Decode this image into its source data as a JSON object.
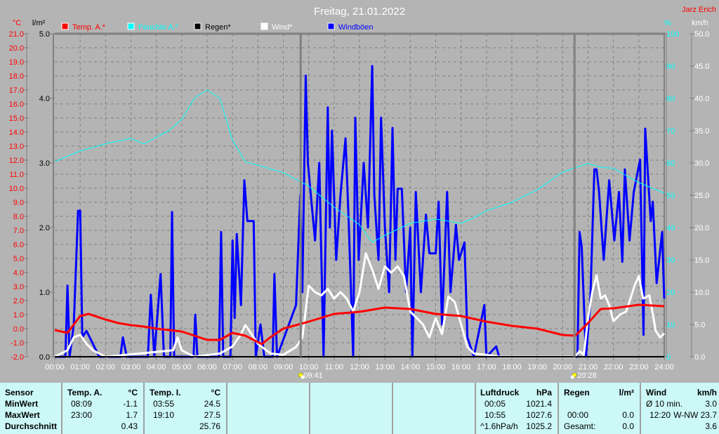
{
  "title": "Freitag, 21.01.2022",
  "author": "Jarz Erich",
  "chart_data": {
    "type": "line",
    "title": "Freitag, 21.01.2022",
    "xlabel": "",
    "x_ticks": [
      "00:00",
      "01:00",
      "02:00",
      "03:00",
      "04:00",
      "05:00",
      "06:00",
      "07:00",
      "08:00",
      "09:00",
      "10:00",
      "11:00",
      "12:00",
      "13:00",
      "14:00",
      "15:00",
      "16:00",
      "17:00",
      "18:00",
      "19:00",
      "20:00",
      "21:00",
      "22:00",
      "23:00",
      "24:00"
    ],
    "xlim": [
      "00:00",
      "24:00"
    ],
    "grid": true,
    "legend_placement": "top",
    "axes": {
      "temp": {
        "unit": "°C",
        "range": [
          -2.0,
          21.0
        ],
        "ticks": [
          "21.0",
          "20.0",
          "19.0",
          "18.0",
          "17.0",
          "16.0",
          "15.0",
          "14.0",
          "13.0",
          "12.0",
          "11.0",
          "10.0",
          "9.0",
          "8.0",
          "7.0",
          "6.0",
          "5.0",
          "4.0",
          "3.0",
          "2.0",
          "1.0",
          "0.0",
          "-1.0",
          "-2.0"
        ],
        "color": "#ff0000"
      },
      "rain": {
        "unit": "l/m²",
        "range": [
          0,
          5.0
        ],
        "ticks": [
          "5.0",
          "4.0",
          "3.0",
          "2.0",
          "1.0",
          "0.0"
        ],
        "color": "#000000"
      },
      "humidity": {
        "unit": "%",
        "range": [
          0,
          100
        ],
        "ticks": [
          "100",
          "90",
          "80",
          "70",
          "60",
          "50",
          "40",
          "30",
          "20",
          "10",
          "0"
        ],
        "color": "#00ffff"
      },
      "wind": {
        "unit": "km/h",
        "range": [
          0,
          50.0
        ],
        "ticks": [
          "50.0",
          "45.0",
          "40.0",
          "35.0",
          "30.0",
          "25.0",
          "20.0",
          "15.0",
          "10.0",
          "5.0",
          "0.0"
        ],
        "color": "#ffffff"
      }
    },
    "markers": [
      {
        "label": "09:41",
        "icon": "sunrise-icon"
      },
      {
        "label": "20:28",
        "icon": "sunset-icon"
      }
    ],
    "series": [
      {
        "name": "Temp. A.*",
        "axis": "temp",
        "color": "#ff0000",
        "points": [
          [
            "00:00",
            -0.1
          ],
          [
            "00:30",
            -0.3
          ],
          [
            "01:00",
            0.9
          ],
          [
            "01:20",
            1.05
          ],
          [
            "02:00",
            0.65
          ],
          [
            "02:30",
            0.4
          ],
          [
            "03:00",
            0.25
          ],
          [
            "03:30",
            0.15
          ],
          [
            "04:00",
            0.0
          ],
          [
            "05:00",
            -0.2
          ],
          [
            "06:00",
            -0.8
          ],
          [
            "06:30",
            -0.8
          ],
          [
            "07:00",
            -0.3
          ],
          [
            "07:30",
            -0.5
          ],
          [
            "08:09",
            -1.1
          ],
          [
            "08:30",
            -0.6
          ],
          [
            "09:00",
            0.0
          ],
          [
            "10:00",
            0.5
          ],
          [
            "11:00",
            1.05
          ],
          [
            "12:00",
            1.2
          ],
          [
            "13:00",
            1.5
          ],
          [
            "14:00",
            1.4
          ],
          [
            "15:00",
            1.05
          ],
          [
            "16:00",
            0.9
          ],
          [
            "17:00",
            0.5
          ],
          [
            "18:00",
            0.2
          ],
          [
            "19:00",
            0.0
          ],
          [
            "20:00",
            -0.45
          ],
          [
            "20:30",
            -0.5
          ],
          [
            "21:00",
            0.4
          ],
          [
            "21:30",
            1.4
          ],
          [
            "22:00",
            1.45
          ],
          [
            "23:00",
            1.7
          ],
          [
            "23:30",
            1.65
          ],
          [
            "24:00",
            1.6
          ]
        ]
      },
      {
        "name": "Feuchte A.*",
        "axis": "humidity",
        "color": "#00ffff",
        "points": [
          [
            "00:00",
            60.4
          ],
          [
            "01:00",
            63.7
          ],
          [
            "02:00",
            65.9
          ],
          [
            "03:00",
            67.6
          ],
          [
            "03:30",
            65.9
          ],
          [
            "04:30",
            70.0
          ],
          [
            "05:00",
            73.5
          ],
          [
            "05:30",
            80.0
          ],
          [
            "06:00",
            82.6
          ],
          [
            "06:30",
            80.0
          ],
          [
            "07:00",
            67.0
          ],
          [
            "07:30",
            60.4
          ],
          [
            "08:00",
            59.3
          ],
          [
            "09:00",
            57.0
          ],
          [
            "10:00",
            52.8
          ],
          [
            "11:00",
            46.3
          ],
          [
            "12:00",
            40.9
          ],
          [
            "12:30",
            35.4
          ],
          [
            "13:00",
            37.6
          ],
          [
            "14:00",
            41.3
          ],
          [
            "15:00",
            42.6
          ],
          [
            "16:00",
            41.3
          ],
          [
            "16:30",
            43.0
          ],
          [
            "17:00",
            45.2
          ],
          [
            "18:00",
            47.8
          ],
          [
            "19:00",
            51.7
          ],
          [
            "20:00",
            57.2
          ],
          [
            "21:00",
            59.8
          ],
          [
            "21:30",
            58.7
          ],
          [
            "22:00",
            58.3
          ],
          [
            "23:00",
            53.9
          ],
          [
            "24:00",
            50.7
          ]
        ]
      },
      {
        "name": "Regen*",
        "axis": "rain",
        "color": "#000000",
        "points": [
          [
            "00:00",
            0.0
          ],
          [
            "24:00",
            0.0
          ]
        ]
      },
      {
        "name": "Wind*",
        "axis": "wind",
        "color": "#ffffff",
        "points": [
          [
            "00:00",
            0
          ],
          [
            "00:30",
            1
          ],
          [
            "00:45",
            3
          ],
          [
            "01:00",
            3.4
          ],
          [
            "01:15",
            2
          ],
          [
            "01:30",
            1
          ],
          [
            "02:00",
            0
          ],
          [
            "04:40",
            1
          ],
          [
            "04:50",
            3
          ],
          [
            "05:00",
            1
          ],
          [
            "05:30",
            0
          ],
          [
            "06:30",
            0.5
          ],
          [
            "07:00",
            1.6
          ],
          [
            "07:20",
            3.5
          ],
          [
            "07:30",
            4.9
          ],
          [
            "07:45",
            3.5
          ],
          [
            "08:00",
            2
          ],
          [
            "08:30",
            0.5
          ],
          [
            "09:00",
            0.3
          ],
          [
            "09:30",
            1.5
          ],
          [
            "09:45",
            3
          ],
          [
            "10:00",
            11
          ],
          [
            "10:15",
            10
          ],
          [
            "10:30",
            9.5
          ],
          [
            "10:45",
            10.5
          ],
          [
            "11:00",
            9
          ],
          [
            "11:15",
            10
          ],
          [
            "11:30",
            9
          ],
          [
            "11:45",
            7
          ],
          [
            "12:00",
            10
          ],
          [
            "12:15",
            16
          ],
          [
            "12:30",
            13.5
          ],
          [
            "12:45",
            10.5
          ],
          [
            "13:00",
            14
          ],
          [
            "13:15",
            13
          ],
          [
            "13:30",
            14
          ],
          [
            "13:45",
            12.5
          ],
          [
            "14:00",
            7
          ],
          [
            "14:15",
            6
          ],
          [
            "14:30",
            5
          ],
          [
            "14:45",
            3
          ],
          [
            "15:00",
            6
          ],
          [
            "15:15",
            3.5
          ],
          [
            "15:30",
            9.3
          ],
          [
            "15:45",
            8.5
          ],
          [
            "16:00",
            5
          ],
          [
            "16:15",
            1.5
          ],
          [
            "16:30",
            0.5
          ],
          [
            "17:00",
            0.3
          ],
          [
            "17:30",
            0
          ],
          [
            "20:30",
            0
          ],
          [
            "20:40",
            0.9
          ],
          [
            "20:50",
            0.3
          ],
          [
            "21:00",
            6
          ],
          [
            "21:10",
            10
          ],
          [
            "21:20",
            12.6
          ],
          [
            "21:30",
            9
          ],
          [
            "21:40",
            9.5
          ],
          [
            "21:50",
            8
          ],
          [
            "22:00",
            5.5
          ],
          [
            "22:15",
            6.5
          ],
          [
            "22:30",
            7
          ],
          [
            "22:50",
            11
          ],
          [
            "23:00",
            12.5
          ],
          [
            "23:10",
            9
          ],
          [
            "23:25",
            9.5
          ],
          [
            "23:40",
            4
          ],
          [
            "23:50",
            3
          ],
          [
            "24:00",
            3.6
          ]
        ]
      },
      {
        "name": "Windböen",
        "axis": "wind",
        "color": "#0000ff",
        "points": [
          [
            "00:00",
            0
          ],
          [
            "00:25",
            0
          ],
          [
            "00:30",
            11
          ],
          [
            "00:35",
            0
          ],
          [
            "00:45",
            5
          ],
          [
            "00:55",
            22.6
          ],
          [
            "01:00",
            22.6
          ],
          [
            "01:05",
            3
          ],
          [
            "01:15",
            4
          ],
          [
            "01:30",
            2
          ],
          [
            "01:45",
            0
          ],
          [
            "02:35",
            0
          ],
          [
            "02:41",
            3
          ],
          [
            "02:50",
            0
          ],
          [
            "03:40",
            0
          ],
          [
            "03:47",
            9.6
          ],
          [
            "03:55",
            0
          ],
          [
            "04:10",
            12.8
          ],
          [
            "04:18",
            0
          ],
          [
            "04:33",
            0
          ],
          [
            "04:37",
            22.4
          ],
          [
            "04:42",
            0
          ],
          [
            "05:28",
            0
          ],
          [
            "05:32",
            6.5
          ],
          [
            "05:37",
            0
          ],
          [
            "06:28",
            0
          ],
          [
            "06:33",
            19.3
          ],
          [
            "06:38",
            0
          ],
          [
            "06:55",
            0
          ],
          [
            "07:00",
            18
          ],
          [
            "07:05",
            6
          ],
          [
            "07:10",
            19
          ],
          [
            "07:20",
            8
          ],
          [
            "07:28",
            27.3
          ],
          [
            "07:35",
            21
          ],
          [
            "07:50",
            21
          ],
          [
            "07:55",
            0
          ],
          [
            "08:06",
            5
          ],
          [
            "08:15",
            0
          ],
          [
            "08:35",
            0
          ],
          [
            "08:39",
            12.8
          ],
          [
            "08:45",
            0
          ],
          [
            "09:30",
            8
          ],
          [
            "09:40",
            25
          ],
          [
            "09:45",
            10
          ],
          [
            "09:53",
            43.5
          ],
          [
            "09:58",
            30
          ],
          [
            "10:05",
            25
          ],
          [
            "10:15",
            18
          ],
          [
            "10:25",
            30
          ],
          [
            "10:35",
            0
          ],
          [
            "10:45",
            38.6
          ],
          [
            "10:50",
            20
          ],
          [
            "10:55",
            35
          ],
          [
            "11:05",
            15
          ],
          [
            "11:15",
            25
          ],
          [
            "11:27",
            33.8
          ],
          [
            "11:35",
            20
          ],
          [
            "11:45",
            0
          ],
          [
            "11:50",
            37
          ],
          [
            "11:58",
            15
          ],
          [
            "12:10",
            30
          ],
          [
            "12:20",
            20
          ],
          [
            "12:30",
            45
          ],
          [
            "12:35",
            25
          ],
          [
            "12:45",
            15
          ],
          [
            "12:51",
            37
          ],
          [
            "13:00",
            20
          ],
          [
            "13:10",
            10
          ],
          [
            "13:18",
            35.4
          ],
          [
            "13:25",
            15
          ],
          [
            "13:30",
            26
          ],
          [
            "13:40",
            26
          ],
          [
            "13:50",
            10
          ],
          [
            "14:00",
            20
          ],
          [
            "14:05",
            0
          ],
          [
            "14:13",
            25.5
          ],
          [
            "14:25",
            10
          ],
          [
            "14:37",
            22
          ],
          [
            "14:45",
            16
          ],
          [
            "15:00",
            16
          ],
          [
            "15:07",
            24
          ],
          [
            "15:15",
            5
          ],
          [
            "15:27",
            25.5
          ],
          [
            "15:35",
            10
          ],
          [
            "15:48",
            20.4
          ],
          [
            "15:55",
            15
          ],
          [
            "16:08",
            17.7
          ],
          [
            "16:15",
            3
          ],
          [
            "16:30",
            0
          ],
          [
            "16:55",
            8
          ],
          [
            "17:00",
            0
          ],
          [
            "17:23",
            1.6
          ],
          [
            "17:30",
            0
          ],
          [
            "20:35",
            0
          ],
          [
            "20:40",
            19.3
          ],
          [
            "20:45",
            17
          ],
          [
            "20:55",
            0
          ],
          [
            "21:05",
            8
          ],
          [
            "21:15",
            29
          ],
          [
            "21:20",
            29
          ],
          [
            "21:26",
            25.5
          ],
          [
            "21:37",
            15
          ],
          [
            "21:50",
            27.3
          ],
          [
            "22:02",
            18
          ],
          [
            "22:13",
            25.5
          ],
          [
            "22:21",
            14.7
          ],
          [
            "22:27",
            29
          ],
          [
            "22:38",
            18
          ],
          [
            "22:48",
            25.5
          ],
          [
            "23:03",
            30.5
          ],
          [
            "23:11",
            3.4
          ],
          [
            "23:15",
            35.3
          ],
          [
            "23:28",
            21
          ],
          [
            "23:33",
            24
          ],
          [
            "23:42",
            11.4
          ],
          [
            "23:55",
            19.3
          ],
          [
            "24:00",
            9
          ]
        ]
      }
    ]
  },
  "table": {
    "sensor": {
      "header": "Sensor",
      "rows": [
        "MinWert",
        "MaxWert",
        "Durchschnitt"
      ]
    },
    "temp_a": {
      "header": "Temp. A.",
      "unit": "°C",
      "min_time": "08:09",
      "min": "-1.1",
      "max_time": "23:00",
      "max": "1.7",
      "avg": "0.43"
    },
    "temp_i": {
      "header": "Temp. I.",
      "unit": "°C",
      "min_time": "03:55",
      "min": "24.5",
      "max_time": "19:10",
      "max": "27.5",
      "avg": "25.76"
    },
    "pressure": {
      "header": "Luftdruck",
      "unit": "hPa",
      "min_time": "00:05",
      "min": "1021.4",
      "max_time": "10:55",
      "max": "1027.6",
      "trend": "^1.6hPa/h",
      "avg": "1025.2"
    },
    "rain": {
      "header": "Regen",
      "unit": "l/m²",
      "time": "00:00",
      "value": "0.0",
      "total_label": "Gesamt:",
      "total": "0.0"
    },
    "wind": {
      "header": "Wind",
      "unit": "km/h",
      "avg_label": "Ø 10 min.",
      "avg": "3.0",
      "max_time": "12:20",
      "max": "W-NW 23.7",
      "mean": "3.6"
    }
  }
}
